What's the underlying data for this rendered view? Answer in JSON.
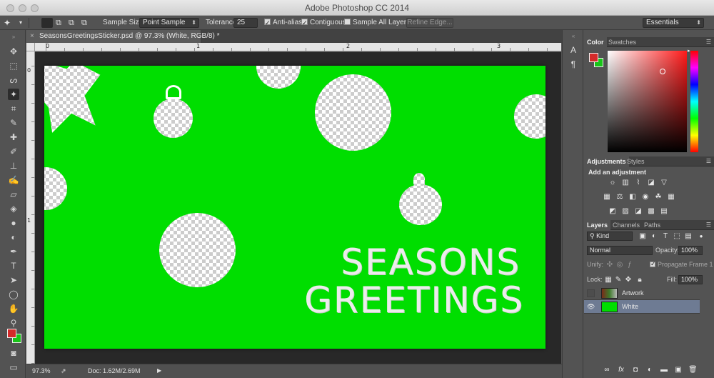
{
  "window": {
    "title": "Adobe Photoshop CC 2014"
  },
  "options_bar": {
    "sample_size_label": "Sample Size:",
    "sample_size_value": "Point Sample",
    "tolerance_label": "Tolerance:",
    "tolerance_value": "25",
    "anti_alias_label": "Anti-alias",
    "contiguous_label": "Contiguous",
    "sample_all_layers_label": "Sample All Layers",
    "refine_edge_label": "Refine Edge...",
    "workspace_value": "Essentials"
  },
  "document": {
    "tab_title": "SeasonsGreetingsSticker.psd @ 97.3% (White, RGB/8) *",
    "close_glyph": "×",
    "canvas_text_line1": "SEASONS",
    "canvas_text_line2": "GREETINGS"
  },
  "rulers": {
    "h_labels": [
      "0",
      "1",
      "2",
      "3"
    ],
    "v_labels": [
      "0",
      "1"
    ]
  },
  "status_bar": {
    "zoom": "97.3%",
    "doc_info": "Doc: 1.62M/2.69M"
  },
  "panels": {
    "color_tabs": [
      "Color",
      "Swatches"
    ],
    "adjustments_tabs": [
      "Adjustments",
      "Styles"
    ],
    "add_adjustment_label": "Add an adjustment",
    "layers_tabs": [
      "Layers",
      "Channels",
      "Paths"
    ],
    "kind_filter": "Kind",
    "blend_mode": "Normal",
    "opacity_label": "Opacity:",
    "opacity_value": "100%",
    "unify_label": "Unify:",
    "propagate_label": "Propagate Frame 1",
    "lock_label": "Lock:",
    "fill_label": "Fill:",
    "fill_value": "100%",
    "layers": [
      {
        "name": "Artwork",
        "visible": false,
        "selected": false
      },
      {
        "name": "White",
        "visible": true,
        "selected": true
      }
    ]
  },
  "colors": {
    "foreground": "#d42a2a",
    "background": "#18c418",
    "canvas_green": "#00de00",
    "selected_layer": "#6e7b93"
  }
}
